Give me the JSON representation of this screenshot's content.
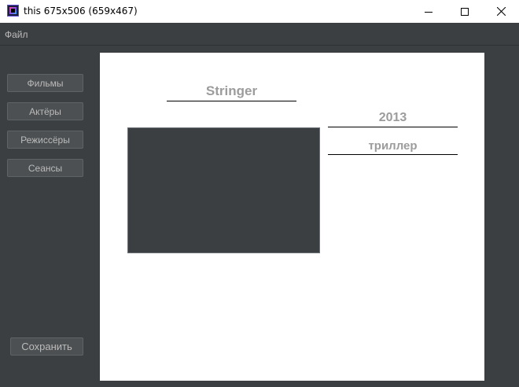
{
  "window": {
    "title": "this 675x506 (659x467)",
    "icon": "intellij-idea-icon"
  },
  "menu": {
    "items": [
      "Файл"
    ]
  },
  "sidebar": {
    "buttons": [
      {
        "label": "Фильмы"
      },
      {
        "label": "Актёры"
      },
      {
        "label": "Режиссёры"
      },
      {
        "label": "Сеансы"
      }
    ],
    "save_label": "Сохранить"
  },
  "movie": {
    "title": "Stringer",
    "year": "2013",
    "genre": "триллер"
  },
  "colors": {
    "background": "#3c3f41",
    "panel": "#ffffff",
    "field_text": "#9c9c9c",
    "button": "#4c5052",
    "button_text": "#bbbbbb"
  }
}
